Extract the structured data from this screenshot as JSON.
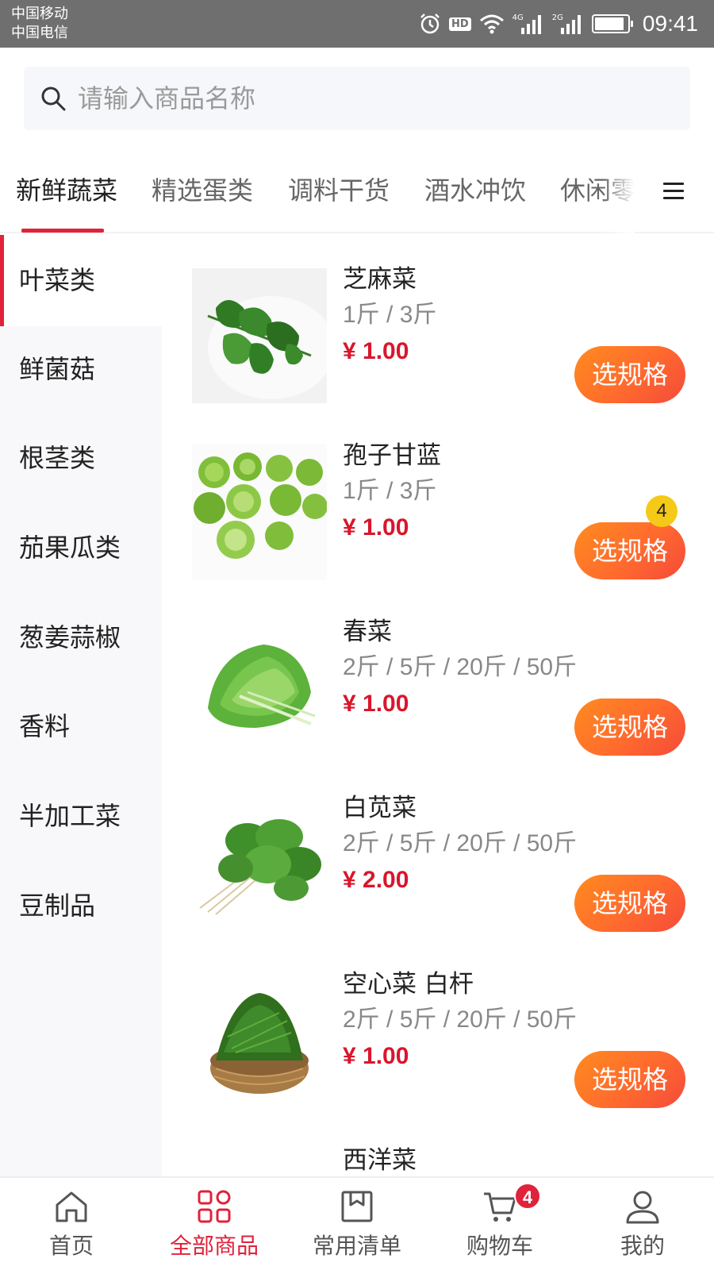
{
  "status_bar": {
    "carrier_1": "中国移动",
    "carrier_2": "中国电信",
    "hd": "HD",
    "net_1": "4G",
    "net_2": "2G",
    "time": "09:41",
    "battery_level": 0.9
  },
  "search": {
    "placeholder": "请输入商品名称"
  },
  "category_tabs": [
    {
      "label": "新鲜蔬菜",
      "active": true
    },
    {
      "label": "精选蛋类",
      "active": false
    },
    {
      "label": "调料干货",
      "active": false
    },
    {
      "label": "酒水冲饮",
      "active": false
    },
    {
      "label": "休闲零",
      "active": false
    }
  ],
  "sidebar": {
    "items": [
      {
        "label": "叶菜类",
        "active": true
      },
      {
        "label": "鲜菌菇",
        "active": false
      },
      {
        "label": "根茎类",
        "active": false
      },
      {
        "label": "茄果瓜类",
        "active": false
      },
      {
        "label": "葱姜蒜椒",
        "active": false
      },
      {
        "label": "香料",
        "active": false
      },
      {
        "label": "半加工菜",
        "active": false
      },
      {
        "label": "豆制品",
        "active": false
      }
    ]
  },
  "products": [
    {
      "name": "芝麻菜",
      "spec": "1斤 / 3斤",
      "price": "¥ 1.00",
      "button": "选规格",
      "image": "arugula-image"
    },
    {
      "name": "孢子甘蓝",
      "spec": "1斤 / 3斤",
      "price": "¥ 1.00",
      "button": "选规格",
      "image": "brussels-sprouts-image",
      "cart_qty": "4"
    },
    {
      "name": "春菜",
      "spec": "2斤 / 5斤 / 20斤 / 50斤",
      "price": "¥ 1.00",
      "button": "选规格",
      "image": "spring-greens-image"
    },
    {
      "name": "白苋菜",
      "spec": "2斤 / 5斤 / 20斤 / 50斤",
      "price": "¥ 2.00",
      "button": "选规格",
      "image": "amaranth-image"
    },
    {
      "name": "空心菜 白杆",
      "spec": "2斤 / 5斤 / 20斤 / 50斤",
      "price": "¥ 1.00",
      "button": "选规格",
      "image": "water-spinach-image"
    },
    {
      "name": "西洋菜",
      "spec": "",
      "price": "",
      "button": "",
      "image": ""
    }
  ],
  "bottom_nav": [
    {
      "label": "首页",
      "icon": "home-icon",
      "active": false
    },
    {
      "label": "全部商品",
      "icon": "grid-icon",
      "active": true
    },
    {
      "label": "常用清单",
      "icon": "list-box-icon",
      "active": false
    },
    {
      "label": "购物车",
      "icon": "cart-icon",
      "active": false,
      "badge": "4"
    },
    {
      "label": "我的",
      "icon": "user-icon",
      "active": false
    }
  ],
  "colors": {
    "accent": "#e0223a",
    "price": "#d9162c",
    "button_gradient_start": "#ff8b1f",
    "button_gradient_end": "#f44a3a",
    "badge_yellow": "#f5c918"
  }
}
